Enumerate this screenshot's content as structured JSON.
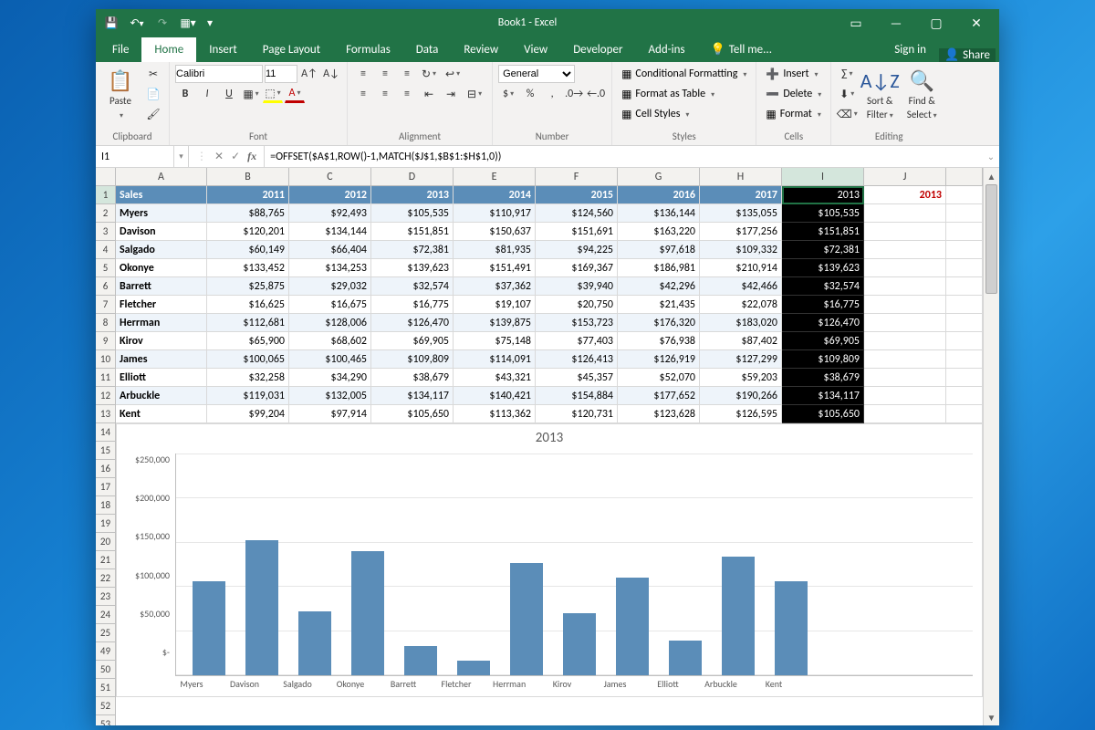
{
  "titlebar": {
    "title": "Book1 - Excel"
  },
  "quick_access": {
    "save": "💾",
    "undo": "↶",
    "redo": "↷",
    "customize": "▾"
  },
  "window_controls": {
    "options": "▭",
    "minimize": "—",
    "maximize": "▢",
    "close": "✕"
  },
  "ribbon_tabs": {
    "file": "File",
    "home": "Home",
    "insert": "Insert",
    "page_layout": "Page Layout",
    "formulas": "Formulas",
    "data": "Data",
    "review": "Review",
    "view": "View",
    "developer": "Developer",
    "addins": "Add-ins",
    "tell_me": "Tell me...",
    "sign_in": "Sign in",
    "share": "Share"
  },
  "ribbon": {
    "clipboard": {
      "label": "Clipboard",
      "paste": "Paste"
    },
    "font": {
      "label": "Font",
      "name": "Calibri",
      "size": "11",
      "bold": "B",
      "italic": "I",
      "underline": "U"
    },
    "alignment": {
      "label": "Alignment",
      "wrap": "Wrap Text",
      "merge": "Merge & Center"
    },
    "number": {
      "label": "Number",
      "format": "General"
    },
    "styles": {
      "label": "Styles",
      "conditional": "Conditional Formatting",
      "table": "Format as Table",
      "cell": "Cell Styles"
    },
    "cells": {
      "label": "Cells",
      "insert": "Insert",
      "delete": "Delete",
      "format": "Format"
    },
    "editing": {
      "label": "Editing",
      "sort": "Sort &",
      "filter": "Filter",
      "find": "Find &",
      "select": "Select"
    }
  },
  "formula_bar": {
    "name_box": "I1",
    "formula": "=OFFSET($A$1,ROW()-1,MATCH($J$1,$B$1:$H$1,0))"
  },
  "columns": [
    "A",
    "B",
    "C",
    "D",
    "E",
    "F",
    "G",
    "H",
    "I",
    "J"
  ],
  "header_row": {
    "label": "Sales",
    "years": [
      "2011",
      "2012",
      "2013",
      "2014",
      "2015",
      "2016",
      "2017"
    ],
    "I1": "2013",
    "J1": "2013"
  },
  "rows": [
    {
      "name": "Myers",
      "vals": [
        "$88,765",
        "$92,493",
        "$105,535",
        "$110,917",
        "$124,560",
        "$136,144",
        "$135,055"
      ],
      "i": "$105,535"
    },
    {
      "name": "Davison",
      "vals": [
        "$120,201",
        "$134,144",
        "$151,851",
        "$150,637",
        "$151,691",
        "$163,220",
        "$177,256"
      ],
      "i": "$151,851"
    },
    {
      "name": "Salgado",
      "vals": [
        "$60,149",
        "$66,404",
        "$72,381",
        "$81,935",
        "$94,225",
        "$97,618",
        "$109,332"
      ],
      "i": "$72,381"
    },
    {
      "name": "Okonye",
      "vals": [
        "$133,452",
        "$134,253",
        "$139,623",
        "$151,491",
        "$169,367",
        "$186,981",
        "$210,914"
      ],
      "i": "$139,623"
    },
    {
      "name": "Barrett",
      "vals": [
        "$25,875",
        "$29,032",
        "$32,574",
        "$37,362",
        "$39,940",
        "$42,296",
        "$42,466"
      ],
      "i": "$32,574"
    },
    {
      "name": "Fletcher",
      "vals": [
        "$16,625",
        "$16,675",
        "$16,775",
        "$19,107",
        "$20,750",
        "$21,435",
        "$22,078"
      ],
      "i": "$16,775"
    },
    {
      "name": "Herrman",
      "vals": [
        "$112,681",
        "$128,006",
        "$126,470",
        "$139,875",
        "$153,723",
        "$176,320",
        "$183,020"
      ],
      "i": "$126,470"
    },
    {
      "name": "Kirov",
      "vals": [
        "$65,900",
        "$68,602",
        "$69,905",
        "$75,148",
        "$77,403",
        "$76,938",
        "$87,402"
      ],
      "i": "$69,905"
    },
    {
      "name": "James",
      "vals": [
        "$100,065",
        "$100,465",
        "$109,809",
        "$114,091",
        "$126,413",
        "$126,919",
        "$127,299"
      ],
      "i": "$109,809"
    },
    {
      "name": "Elliott",
      "vals": [
        "$32,258",
        "$34,290",
        "$38,679",
        "$43,321",
        "$45,357",
        "$52,070",
        "$59,203"
      ],
      "i": "$38,679"
    },
    {
      "name": "Arbuckle",
      "vals": [
        "$119,031",
        "$132,005",
        "$134,117",
        "$140,421",
        "$154,884",
        "$177,652",
        "$190,266"
      ],
      "i": "$134,117"
    },
    {
      "name": "Kent",
      "vals": [
        "$99,204",
        "$97,914",
        "$105,650",
        "$113,362",
        "$120,731",
        "$123,628",
        "$126,595"
      ],
      "i": "$105,650"
    }
  ],
  "chart_row_start": 14,
  "chart_row_labels": [
    "14",
    "15",
    "16",
    "17",
    "18",
    "19",
    "20",
    "21",
    "22",
    "23",
    "24",
    "25",
    "49",
    "50",
    "51",
    "52",
    "53"
  ],
  "chart_data": {
    "type": "bar",
    "title": "2013",
    "categories": [
      "Myers",
      "Davison",
      "Salgado",
      "Okonye",
      "Barrett",
      "Fletcher",
      "Herrman",
      "Kirov",
      "James",
      "Elliott",
      "Arbuckle",
      "Kent"
    ],
    "values": [
      105535,
      151851,
      72381,
      139623,
      32574,
      16775,
      126470,
      69905,
      109809,
      38679,
      134117,
      105650
    ],
    "ylabel": "",
    "xlabel": "",
    "ylim": [
      0,
      250000
    ],
    "yticks": [
      "$250,000",
      "$200,000",
      "$150,000",
      "$100,000",
      "$50,000",
      "$-"
    ]
  }
}
